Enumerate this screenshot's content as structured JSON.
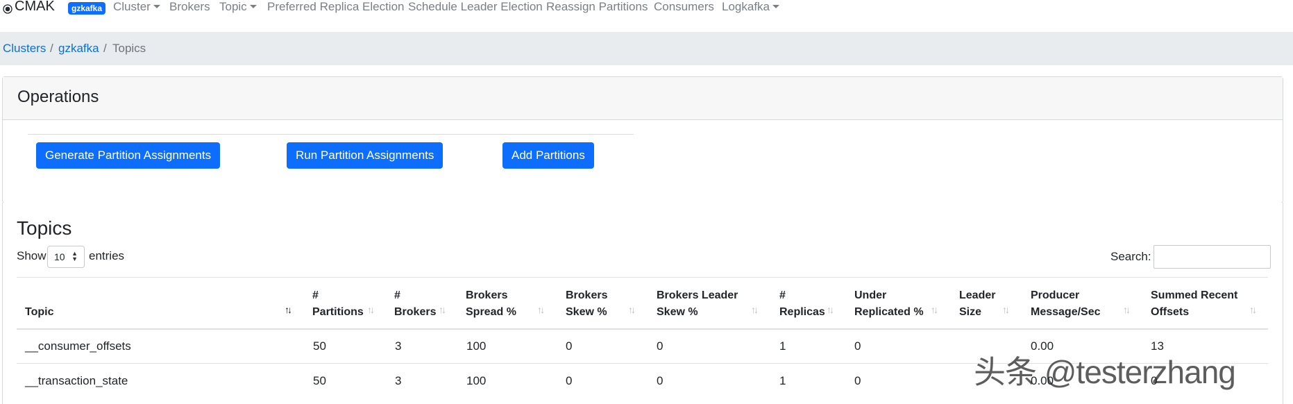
{
  "navbar": {
    "brand": "CMAK",
    "cluster_badge": "gzkafka",
    "items": [
      {
        "label": "Cluster",
        "dropdown": true
      },
      {
        "label": "Brokers",
        "dropdown": false
      },
      {
        "label": "Topic",
        "dropdown": true
      },
      {
        "label": "Preferred Replica Election",
        "dropdown": false
      },
      {
        "label": "Schedule Leader Election",
        "dropdown": false
      },
      {
        "label": "Reassign Partitions",
        "dropdown": false
      },
      {
        "label": "Consumers",
        "dropdown": false
      },
      {
        "label": "Logkafka",
        "dropdown": true
      }
    ]
  },
  "breadcrumb": {
    "items": [
      "Clusters",
      "gzkafka",
      "Topics"
    ],
    "separator": "/"
  },
  "operations": {
    "title": "Operations",
    "buttons": [
      "Generate Partition Assignments",
      "Run Partition Assignments",
      "Add Partitions"
    ]
  },
  "topics": {
    "title": "Topics",
    "show_label": "Show",
    "page_size": "10",
    "entries_label": "entries",
    "search_label": "Search:",
    "search_value": "",
    "columns": [
      [
        "Topic"
      ],
      [
        "#",
        "Partitions"
      ],
      [
        "#",
        "Brokers"
      ],
      [
        "Brokers",
        "Spread %"
      ],
      [
        "Brokers",
        "Skew %"
      ],
      [
        "Brokers Leader",
        "Skew %"
      ],
      [
        "#",
        "Replicas"
      ],
      [
        "Under",
        "Replicated %"
      ],
      [
        "Leader",
        "Size"
      ],
      [
        "Producer",
        "Message/Sec"
      ],
      [
        "Summed Recent",
        "Offsets"
      ]
    ],
    "sorted_column": "Topic",
    "sort_direction": "ascending",
    "rows": [
      [
        "__consumer_offsets",
        "50",
        "3",
        "100",
        "0",
        "0",
        "1",
        "0",
        "",
        "0.00",
        "13"
      ],
      [
        "__transaction_state",
        "50",
        "3",
        "100",
        "0",
        "0",
        "1",
        "0",
        "",
        "0.00",
        "0"
      ]
    ]
  },
  "watermark": "头条 @testerzhang",
  "colors": {
    "primary": "#0d6efd",
    "link": "#0a6fd8",
    "breadcrumb_bg": "#e9ecef",
    "nav_text": "#7a7f85"
  }
}
